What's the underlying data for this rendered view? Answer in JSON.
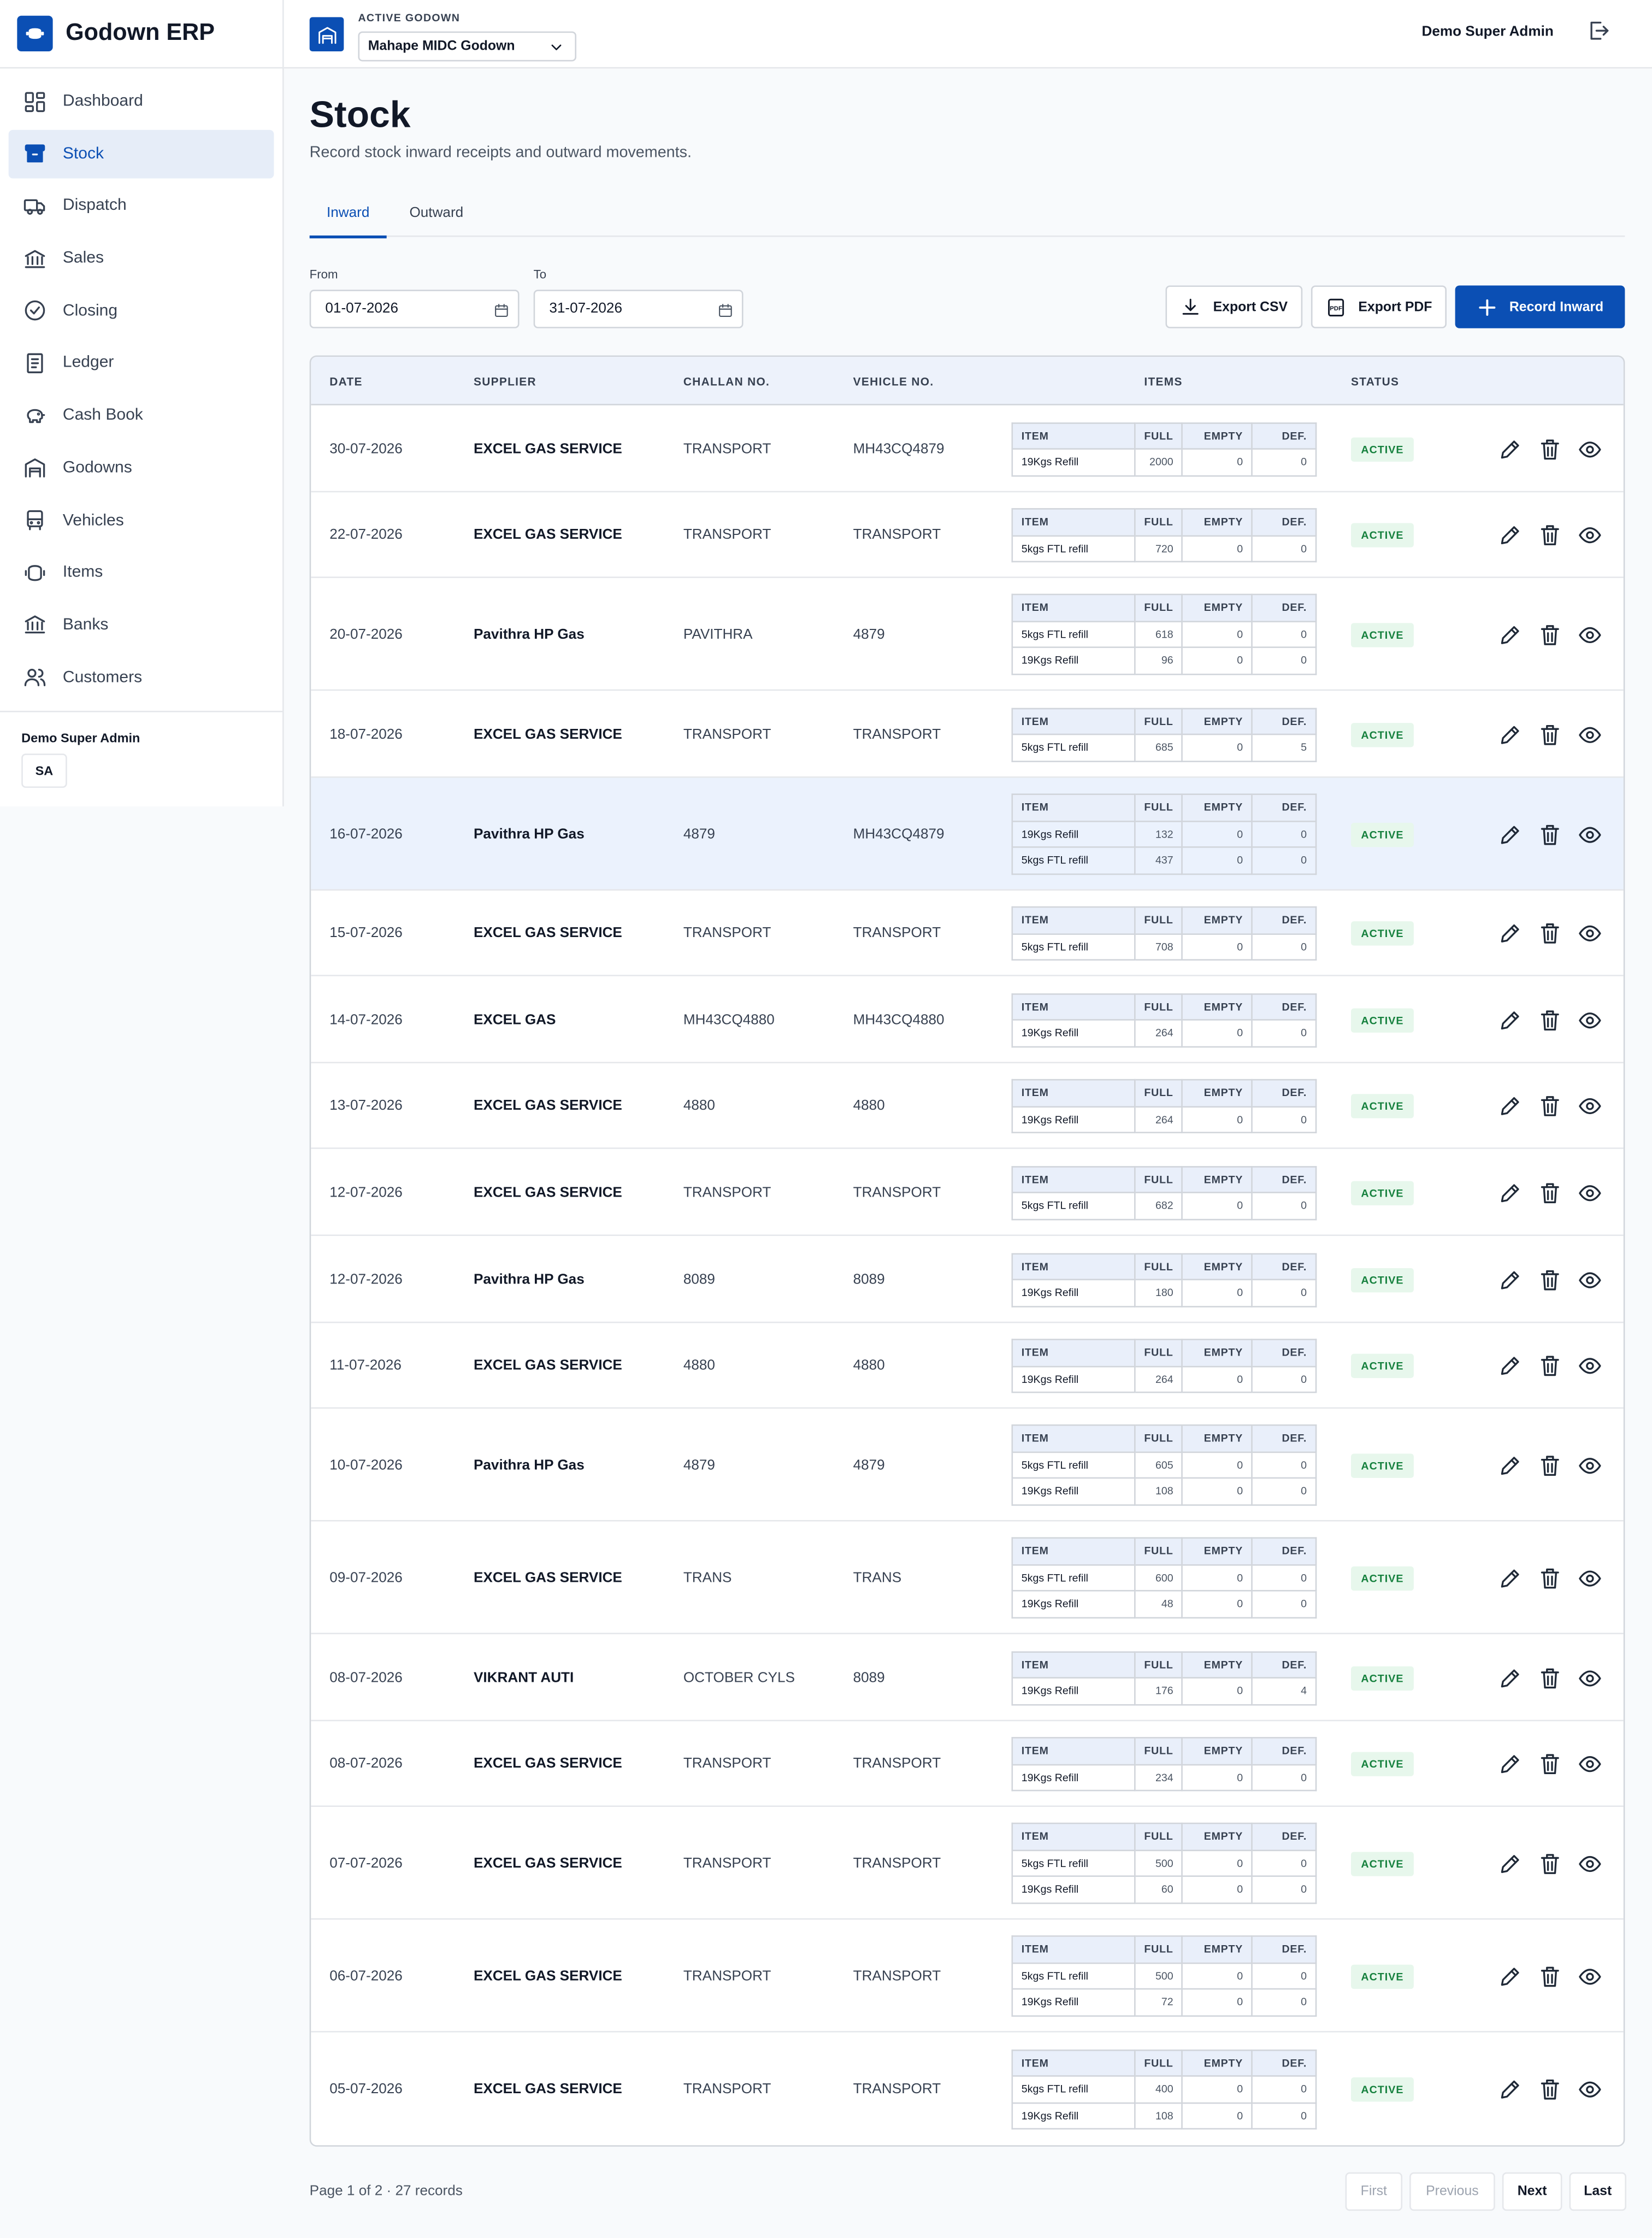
{
  "app": {
    "name": "Godown ERP"
  },
  "sidebar": {
    "items": [
      {
        "label": "Dashboard",
        "icon": "dashboard-icon"
      },
      {
        "label": "Stock",
        "icon": "archive-box-icon",
        "active": true
      },
      {
        "label": "Dispatch",
        "icon": "truck-icon"
      },
      {
        "label": "Sales",
        "icon": "bank-icon"
      },
      {
        "label": "Closing",
        "icon": "check-circle-icon"
      },
      {
        "label": "Ledger",
        "icon": "ledger-icon"
      },
      {
        "label": "Cash Book",
        "icon": "piggy-bank-icon"
      },
      {
        "label": "Godowns",
        "icon": "warehouse-icon"
      },
      {
        "label": "Vehicles",
        "icon": "bus-icon"
      },
      {
        "label": "Items",
        "icon": "cylinder-icon"
      },
      {
        "label": "Banks",
        "icon": "bank-icon"
      },
      {
        "label": "Customers",
        "icon": "users-icon"
      }
    ],
    "user_name": "Demo Super Admin",
    "user_initials": "SA"
  },
  "header": {
    "active_godown_label": "ACTIVE GODOWN",
    "godown": "Mahape MIDC Godown",
    "user_name": "Demo Super Admin"
  },
  "page": {
    "title": "Stock",
    "subtitle": "Record stock inward receipts and outward movements.",
    "tabs": [
      "Inward",
      "Outward"
    ],
    "active_tab": "Inward"
  },
  "filters": {
    "from_label": "From",
    "from_value": "01-07-2026",
    "to_label": "To",
    "to_value": "31-07-2026"
  },
  "actions": {
    "export_csv": "Export CSV",
    "export_pdf": "Export PDF",
    "record_inward": "Record Inward"
  },
  "table": {
    "columns": [
      "DATE",
      "SUPPLIER",
      "CHALLAN NO.",
      "VEHICLE NO.",
      "ITEMS",
      "STATUS"
    ],
    "item_columns": [
      "ITEM",
      "FULL",
      "EMPTY",
      "DEF."
    ],
    "rows": [
      {
        "date": "30-07-2026",
        "supplier": "EXCEL GAS SERVICE",
        "challan": "TRANSPORT",
        "vehicle": "MH43CQ4879",
        "status": "ACTIVE",
        "items": [
          {
            "item": "19Kgs Refill",
            "full": "2000",
            "empty": "0",
            "def": "0"
          }
        ]
      },
      {
        "date": "22-07-2026",
        "supplier": "EXCEL GAS SERVICE",
        "challan": "TRANSPORT",
        "vehicle": "TRANSPORT",
        "status": "ACTIVE",
        "items": [
          {
            "item": "5kgs FTL refill",
            "full": "720",
            "empty": "0",
            "def": "0"
          }
        ]
      },
      {
        "date": "20-07-2026",
        "supplier": "Pavithra HP Gas",
        "challan": "PAVITHRA",
        "vehicle": "4879",
        "status": "ACTIVE",
        "items": [
          {
            "item": "5kgs FTL refill",
            "full": "618",
            "empty": "0",
            "def": "0"
          },
          {
            "item": "19Kgs Refill",
            "full": "96",
            "empty": "0",
            "def": "0"
          }
        ]
      },
      {
        "date": "18-07-2026",
        "supplier": "EXCEL GAS SERVICE",
        "challan": "TRANSPORT",
        "vehicle": "TRANSPORT",
        "status": "ACTIVE",
        "items": [
          {
            "item": "5kgs FTL refill",
            "full": "685",
            "empty": "0",
            "def": "5"
          }
        ]
      },
      {
        "date": "16-07-2026",
        "supplier": "Pavithra HP Gas",
        "challan": "4879",
        "vehicle": "MH43CQ4879",
        "status": "ACTIVE",
        "highlight": true,
        "items": [
          {
            "item": "19Kgs Refill",
            "full": "132",
            "empty": "0",
            "def": "0"
          },
          {
            "item": "5kgs FTL refill",
            "full": "437",
            "empty": "0",
            "def": "0"
          }
        ]
      },
      {
        "date": "15-07-2026",
        "supplier": "EXCEL GAS SERVICE",
        "challan": "TRANSPORT",
        "vehicle": "TRANSPORT",
        "status": "ACTIVE",
        "items": [
          {
            "item": "5kgs FTL refill",
            "full": "708",
            "empty": "0",
            "def": "0"
          }
        ]
      },
      {
        "date": "14-07-2026",
        "supplier": "EXCEL GAS",
        "challan": "MH43CQ4880",
        "vehicle": "MH43CQ4880",
        "status": "ACTIVE",
        "items": [
          {
            "item": "19Kgs Refill",
            "full": "264",
            "empty": "0",
            "def": "0"
          }
        ]
      },
      {
        "date": "13-07-2026",
        "supplier": "EXCEL GAS SERVICE",
        "challan": "4880",
        "vehicle": "4880",
        "status": "ACTIVE",
        "items": [
          {
            "item": "19Kgs Refill",
            "full": "264",
            "empty": "0",
            "def": "0"
          }
        ]
      },
      {
        "date": "12-07-2026",
        "supplier": "EXCEL GAS SERVICE",
        "challan": "TRANSPORT",
        "vehicle": "TRANSPORT",
        "status": "ACTIVE",
        "items": [
          {
            "item": "5kgs FTL refill",
            "full": "682",
            "empty": "0",
            "def": "0"
          }
        ]
      },
      {
        "date": "12-07-2026",
        "supplier": "Pavithra HP Gas",
        "challan": "8089",
        "vehicle": "8089",
        "status": "ACTIVE",
        "items": [
          {
            "item": "19Kgs Refill",
            "full": "180",
            "empty": "0",
            "def": "0"
          }
        ]
      },
      {
        "date": "11-07-2026",
        "supplier": "EXCEL GAS SERVICE",
        "challan": "4880",
        "vehicle": "4880",
        "status": "ACTIVE",
        "items": [
          {
            "item": "19Kgs Refill",
            "full": "264",
            "empty": "0",
            "def": "0"
          }
        ]
      },
      {
        "date": "10-07-2026",
        "supplier": "Pavithra HP Gas",
        "challan": "4879",
        "vehicle": "4879",
        "status": "ACTIVE",
        "items": [
          {
            "item": "5kgs FTL refill",
            "full": "605",
            "empty": "0",
            "def": "0"
          },
          {
            "item": "19Kgs Refill",
            "full": "108",
            "empty": "0",
            "def": "0"
          }
        ]
      },
      {
        "date": "09-07-2026",
        "supplier": "EXCEL GAS SERVICE",
        "challan": "TRANS",
        "vehicle": "TRANS",
        "status": "ACTIVE",
        "items": [
          {
            "item": "5kgs FTL refill",
            "full": "600",
            "empty": "0",
            "def": "0"
          },
          {
            "item": "19Kgs Refill",
            "full": "48",
            "empty": "0",
            "def": "0"
          }
        ]
      },
      {
        "date": "08-07-2026",
        "supplier": "VIKRANT AUTI",
        "challan": "OCTOBER CYLS",
        "vehicle": "8089",
        "status": "ACTIVE",
        "items": [
          {
            "item": "19Kgs Refill",
            "full": "176",
            "empty": "0",
            "def": "4"
          }
        ]
      },
      {
        "date": "08-07-2026",
        "supplier": "EXCEL GAS SERVICE",
        "challan": "TRANSPORT",
        "vehicle": "TRANSPORT",
        "status": "ACTIVE",
        "items": [
          {
            "item": "19Kgs Refill",
            "full": "234",
            "empty": "0",
            "def": "0"
          }
        ]
      },
      {
        "date": "07-07-2026",
        "supplier": "EXCEL GAS SERVICE",
        "challan": "TRANSPORT",
        "vehicle": "TRANSPORT",
        "status": "ACTIVE",
        "items": [
          {
            "item": "5kgs FTL refill",
            "full": "500",
            "empty": "0",
            "def": "0"
          },
          {
            "item": "19Kgs Refill",
            "full": "60",
            "empty": "0",
            "def": "0"
          }
        ]
      },
      {
        "date": "06-07-2026",
        "supplier": "EXCEL GAS SERVICE",
        "challan": "TRANSPORT",
        "vehicle": "TRANSPORT",
        "status": "ACTIVE",
        "items": [
          {
            "item": "5kgs FTL refill",
            "full": "500",
            "empty": "0",
            "def": "0"
          },
          {
            "item": "19Kgs Refill",
            "full": "72",
            "empty": "0",
            "def": "0"
          }
        ]
      },
      {
        "date": "05-07-2026",
        "supplier": "EXCEL GAS SERVICE",
        "challan": "TRANSPORT",
        "vehicle": "TRANSPORT",
        "status": "ACTIVE",
        "items": [
          {
            "item": "5kgs FTL refill",
            "full": "400",
            "empty": "0",
            "def": "0"
          },
          {
            "item": "19Kgs Refill",
            "full": "108",
            "empty": "0",
            "def": "0"
          }
        ]
      }
    ]
  },
  "pagination": {
    "info": "Page 1 of 2 · 27 records",
    "first": "First",
    "previous": "Previous",
    "next": "Next",
    "last": "Last"
  },
  "colors": {
    "accent": "#0b4fb4",
    "status_bg": "#e7f7ec",
    "status_text": "#15803d",
    "highlight_row": "#ebf2fd"
  }
}
